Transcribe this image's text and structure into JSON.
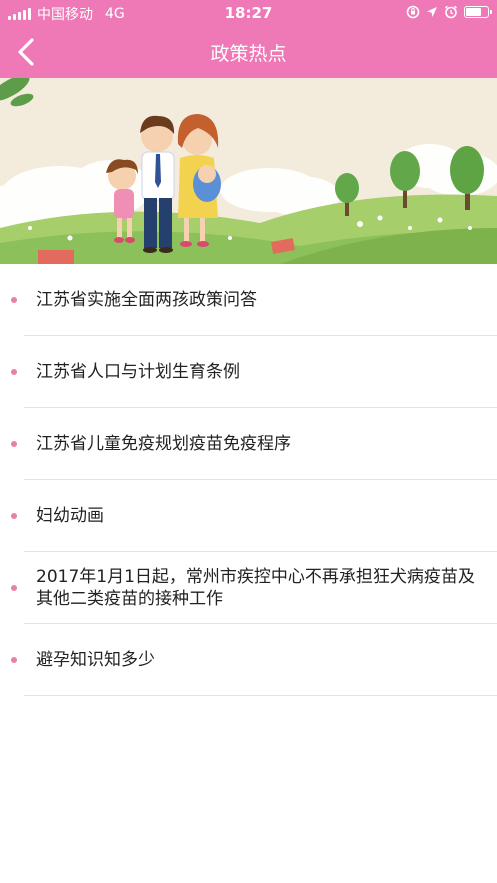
{
  "status_bar": {
    "carrier": "中国移动",
    "network": "4G",
    "time": "18:27",
    "battery_level": 0.75
  },
  "nav": {
    "title": "政策热点",
    "back_icon": "chevron-left-icon"
  },
  "banner": {
    "alt": "family-illustration"
  },
  "policies": [
    {
      "title": "江苏省实施全面两孩政策问答"
    },
    {
      "title": "江苏省人口与计划生育条例"
    },
    {
      "title": "江苏省儿童免疫规划疫苗免疫程序"
    },
    {
      "title": "妇幼动画"
    },
    {
      "title": "2017年1月1日起，常州市疾控中心不再承担狂犬病疫苗及其他二类疫苗的接种工作"
    },
    {
      "title": "避孕知识知多少"
    }
  ],
  "colors": {
    "header": "#ee79b6",
    "bullet": "#e8839f",
    "divider": "#e3e3e3"
  }
}
